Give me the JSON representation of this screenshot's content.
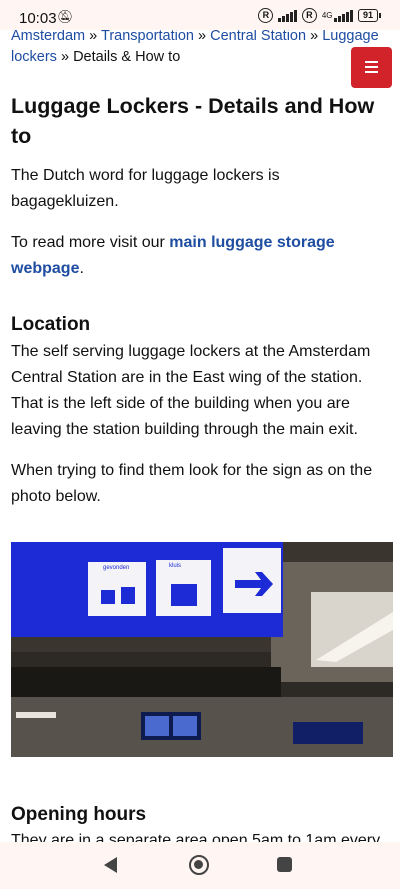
{
  "status_bar": {
    "time": "10:03",
    "battery": "91",
    "network": "4G"
  },
  "breadcrumb": {
    "items": [
      "Amsterdam",
      "Transportation",
      "Central Station",
      "Luggage lockers"
    ],
    "separator": "»",
    "current": "Details & How to"
  },
  "menu_button": {
    "icon": "hamburger-icon",
    "color": "#d3232a"
  },
  "page": {
    "title": "Luggage Lockers - Details and How to",
    "intro": "The Dutch word for luggage lockers is bagagekluizen.",
    "read_more_prefix": "To read more visit our ",
    "read_more_link": "main luggage storage webpage",
    "read_more_suffix": ".",
    "location_heading": "Location",
    "location_text": "The self serving luggage lockers at the Amsterdam Central Station are in the East wing of the station. That is the left side of the building when you are leaving the station building through the main exit.",
    "find_text": "When trying to find them look for the sign as on the photo below.",
    "opening_heading": "Opening hours",
    "opening_text": "They are in a separate area open 5am to 1am every"
  },
  "photo": {
    "sign_labels": [
      "gevonden",
      "kluis"
    ],
    "sign_color": "#1d2bd6"
  },
  "colors": {
    "link": "#1e4da1",
    "bar_bg": "#fff6f4"
  }
}
